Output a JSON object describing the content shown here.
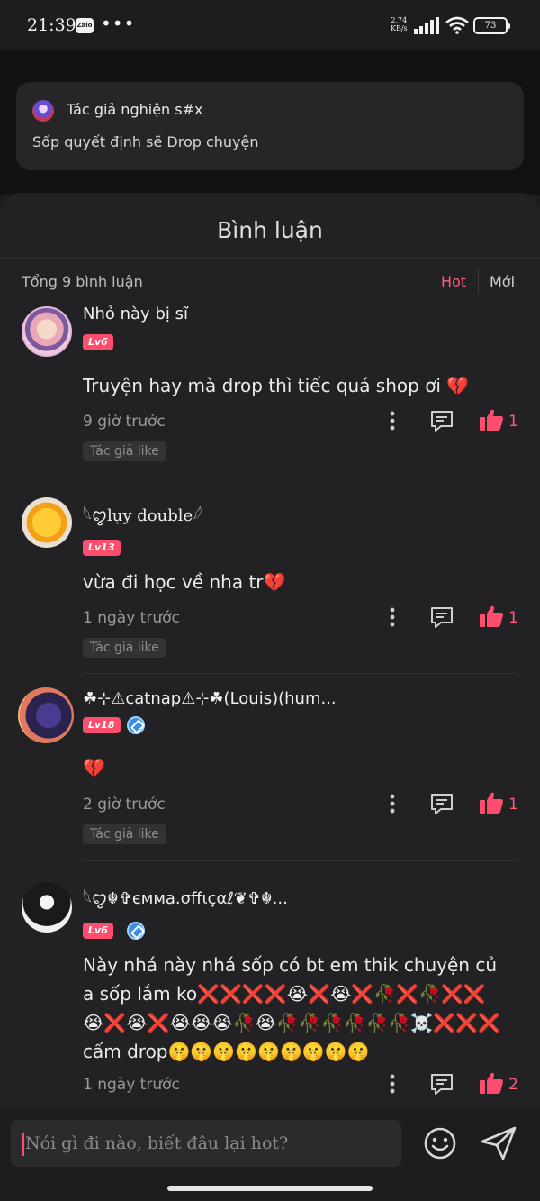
{
  "status_bar": {
    "time": "21:39",
    "zalo_icon": "Zalo",
    "overflow": "•••",
    "net_speed_value": "2,74",
    "net_speed_unit": "KB/s",
    "battery": "73"
  },
  "preview_card": {
    "author": "Tác giả nghiện s#x",
    "text": "Sốp quyết định sẽ Drop chuyện"
  },
  "comments_sheet": {
    "title": "Bình luận",
    "total": "Tổng 9 bình luận",
    "sort_hot": "Hot",
    "sort_new": "Mới"
  },
  "comments": [
    {
      "name": "Nhỏ này bị sĩ",
      "level": "Lv6",
      "verified": false,
      "text": "Truyện hay mà drop thì tiếc quá shop ơi 💔",
      "time": "9 giờ trước",
      "likes": "1",
      "tag": "Tác giả like"
    },
    {
      "name": "𓆩ꨄ︎lụy double𓆪",
      "level": "Lv13",
      "verified": false,
      "text": "vừa đi học về nha tr💔",
      "time": "1 ngày trước",
      "likes": "1",
      "tag": "Tác giả like"
    },
    {
      "name": "☘︎⊹⚠︎catnap⚠︎⊹☘︎(Louis)(hum...",
      "level": "Lv18",
      "verified": true,
      "text": "💔",
      "time": "2 giờ trước",
      "likes": "1",
      "tag": "Tác giả like"
    },
    {
      "name": "𓆩ꨄ︎☬✞ємма.σffιçαℓ❦︎✞☬...",
      "level": "Lv6",
      "verified": true,
      "text": "Này nhá này nhá sốp có bt em thik chuyện của sốp lắm ko❌❌❌❌😭❌😭❌🥀❌🥀❌❌😭❌😭❌😭😭😭🥀😭🥀🥀🥀🥀🥀🥀☠️❌❌❌cấm drop🤫🤫🤫🤫🤫🤫🤫🤫🤫",
      "time": "1 ngày trước",
      "likes": "2",
      "tag": ""
    }
  ],
  "composer": {
    "placeholder": "Nói gì đi nào, biết đâu lại hot?"
  },
  "colors": {
    "accent": "#ff4d6d",
    "background": "#222224",
    "card": "#262629"
  },
  "icons": [
    "more-vertical-icon",
    "reply-icon",
    "thumbs-up-icon",
    "smiley-icon",
    "send-icon",
    "verified-icon"
  ]
}
